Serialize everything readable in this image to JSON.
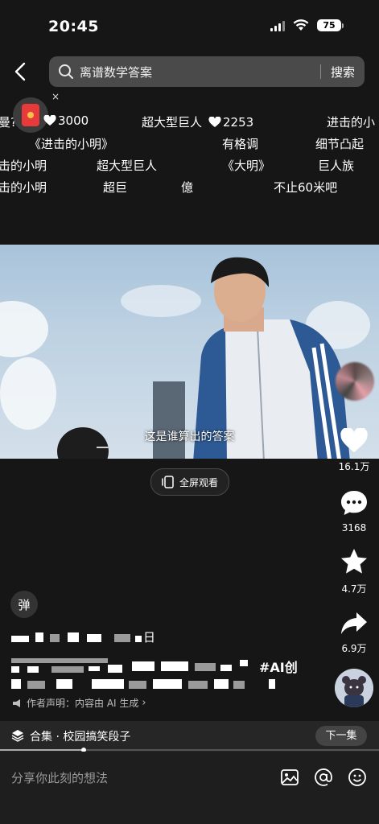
{
  "status": {
    "time": "20:45",
    "battery": "75"
  },
  "search": {
    "query": "离谱数学答案",
    "button": "搜索"
  },
  "danmu": {
    "row1": [
      {
        "text": "曼?",
        "likes": "3000"
      },
      {
        "text": "超大型巨人",
        "likes": "2253"
      },
      {
        "text": "进击的小"
      }
    ],
    "row2": [
      "《进击的小明》",
      "有格调",
      "细节凸起"
    ],
    "row3": [
      "击的小明",
      "超大型巨人",
      "《大明》",
      "巨人族"
    ],
    "row4": [
      "击的小明",
      "超巨",
      "億",
      "不止60米吧"
    ]
  },
  "video": {
    "subtitle": "这是谁算出的答案"
  },
  "fullscreen": {
    "label": "全屏观看"
  },
  "rail": {
    "likes": "16.1万",
    "comments": "3168",
    "favorites": "4.7万",
    "shares": "6.9万"
  },
  "danmu_toggle": "弹",
  "caption": {
    "date_suffix": "日",
    "hashtag": "#AI创",
    "statement": "作者声明：内容由 AI 生成"
  },
  "collection": {
    "label": "合集 · 校园搞笑段子",
    "next": "下一集",
    "progress": 0.22
  },
  "comment": {
    "placeholder": "分享你此刻的想法"
  }
}
